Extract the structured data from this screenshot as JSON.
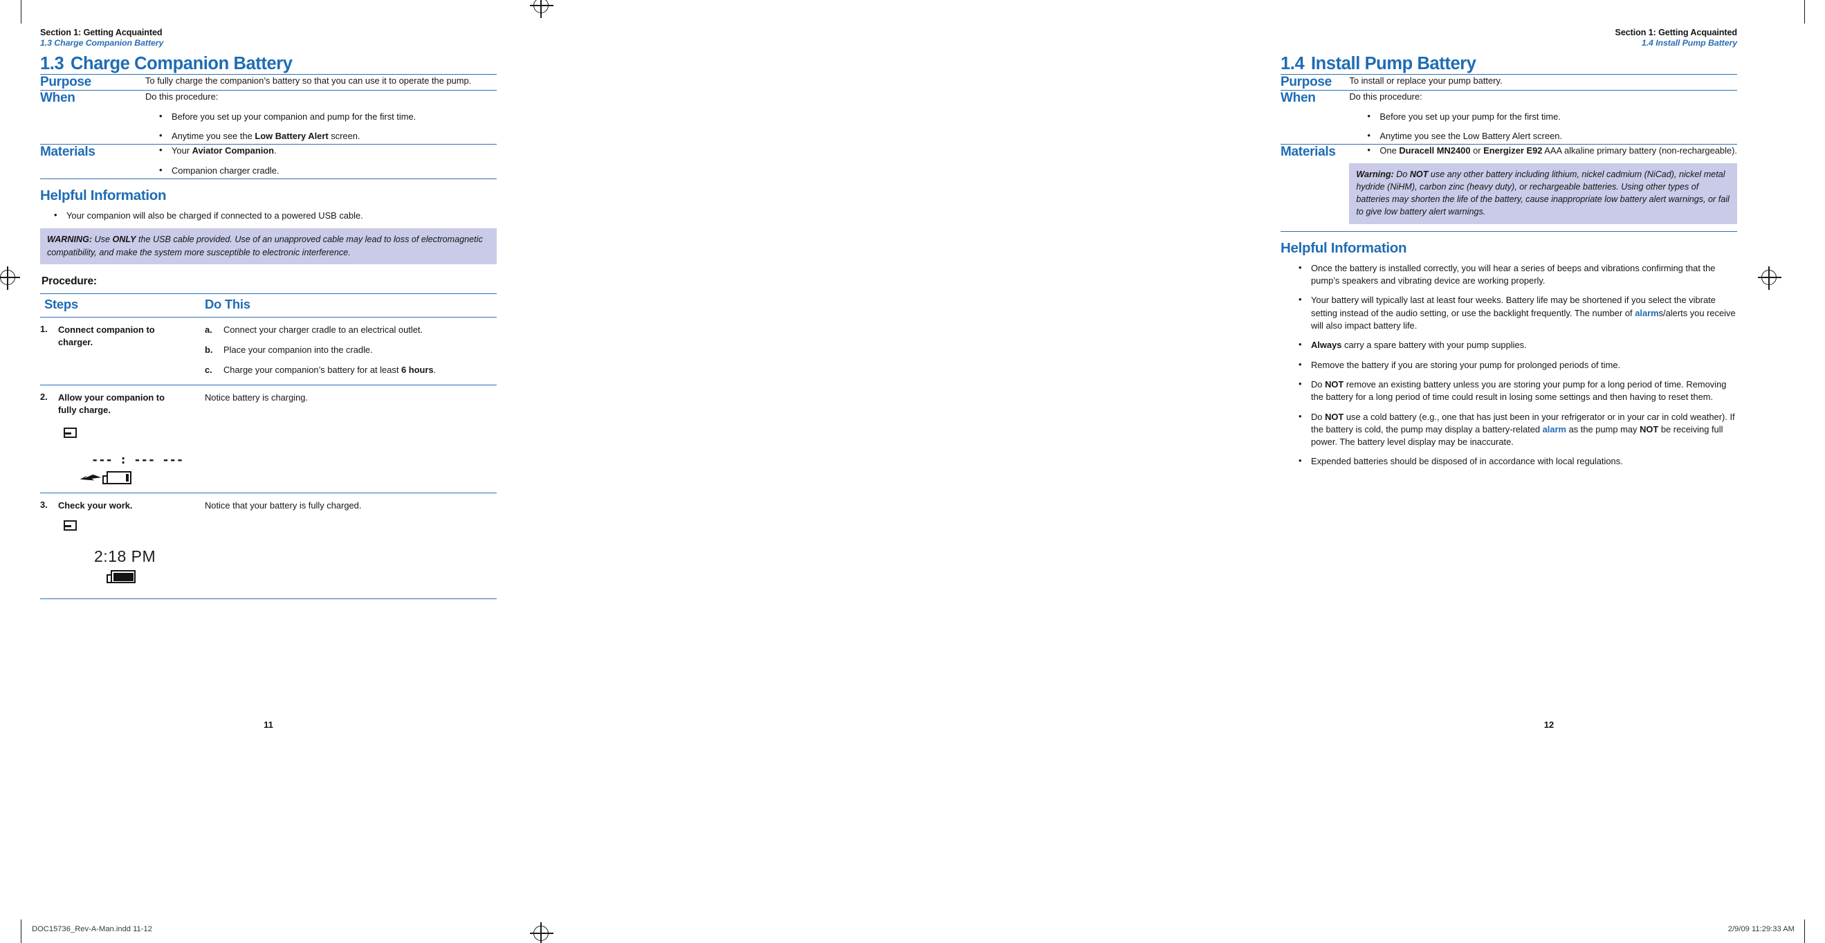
{
  "accent_color": "#1f6cb4",
  "warning_bg": "#c9cbe8",
  "left_page": {
    "runhead": {
      "section": "Section 1: Getting Acquainted",
      "subsection": "1.3 Charge Companion Battery"
    },
    "chapter": {
      "number": "1.3",
      "title": "Charge Companion Battery"
    },
    "info": {
      "purpose_label": "Purpose",
      "purpose_text": "To fully charge the companion’s battery so that you can use it to operate the pump.",
      "when_label": "When",
      "when_intro": "Do this procedure:",
      "when_bullets": [
        {
          "pre": "Before you set up your companion and pump for the first time.",
          "bold": "",
          "post": ""
        },
        {
          "pre": "Anytime you see the ",
          "bold": "Low Battery Alert",
          "post": " screen."
        }
      ],
      "materials_label": "Materials",
      "materials_bullets": [
        {
          "pre": "Your ",
          "bold": "Aviator Companion",
          "post": "."
        },
        {
          "pre": "Companion charger cradle.",
          "bold": "",
          "post": ""
        }
      ]
    },
    "helpful": {
      "heading": "Helpful Information",
      "bullets": [
        "Your companion will also be charged if connected to a powered USB cable."
      ]
    },
    "warning": {
      "lead": "WARNING:",
      "part1": " Use ",
      "emphasis": "ONLY",
      "part2": " the USB cable provided. Use of an unapproved cable may lead to loss of electromagnetic compatibility, and make the system more susceptible to electronic interference."
    },
    "procedure_heading": "Procedure:",
    "procedure": {
      "col_steps": "Steps",
      "col_do": "Do This",
      "rows": [
        {
          "num": "1.",
          "title": "Connect companion to charger.",
          "substeps": [
            {
              "letter": "a.",
              "pre": "Connect your charger cradle to an electrical outlet.",
              "bold": "",
              "post": ""
            },
            {
              "letter": "b.",
              "pre": "Place your companion into the cradle.",
              "bold": "",
              "post": ""
            },
            {
              "letter": "c.",
              "pre": "Charge your companion’s battery for at least ",
              "bold": "6 hours",
              "post": "."
            }
          ],
          "do_text": ""
        },
        {
          "num": "2.",
          "title": "Allow your companion to fully charge.",
          "substeps": [],
          "do_text": "Notice battery is charging.",
          "screen": {
            "logo": "abbott-logo-icon",
            "time": "--- : ---  ---",
            "battery": "low",
            "charging": true
          }
        },
        {
          "num": "3.",
          "title": "Check your work.",
          "substeps": [],
          "do_text": "Notice that your battery is fully charged.",
          "screen": {
            "logo": "abbott-logo-icon",
            "time": "2:18 PM",
            "battery": "full",
            "charging": false
          }
        }
      ]
    },
    "folio": "11"
  },
  "right_page": {
    "runhead": {
      "section": "Section 1: Getting Acquainted",
      "subsection": "1.4 Install Pump Battery"
    },
    "chapter": {
      "number": "1.4",
      "title": "Install Pump Battery"
    },
    "info": {
      "purpose_label": "Purpose",
      "purpose_text": "To install or replace your pump battery.",
      "when_label": "When",
      "when_intro": "Do this procedure:",
      "when_bullets": [
        {
          "pre": "Before you set up your pump for the first time.",
          "bold": "",
          "post": ""
        },
        {
          "pre": "Anytime you see the Low Battery Alert screen.",
          "bold": "",
          "post": ""
        }
      ],
      "materials_label": "Materials",
      "materials_bullets": [
        {
          "pre": "One ",
          "bold": "Duracell MN2400",
          "mid": " or ",
          "bold2": "Energizer E92",
          "post": " AAA alkaline primary battery (non-rechargeable)."
        }
      ]
    },
    "warning": {
      "lead": "Warning:",
      "part1": " Do ",
      "emphasis": "NOT",
      "part2": " use any other battery including lithium, nickel cadmium (NiCad), nickel metal hydride (NiHM), carbon zinc (heavy duty), or rechargeable batteries. Using other types of batteries may shorten the life of the battery, cause inappropriate low battery alert warnings, or fail to give low battery alert warnings."
    },
    "helpful": {
      "heading": "Helpful Information",
      "bullets": [
        {
          "segments": [
            {
              "t": "Once the battery is installed correctly, you will hear a series of beeps and vibrations confirming that the pump’s speakers and vibrating device are working properly.",
              "s": "n"
            }
          ]
        },
        {
          "segments": [
            {
              "t": "Your battery will typically last at least four weeks. Battery life may be shortened if you select the vibrate setting instead of the audio setting, or use the backlight frequently. The number of ",
              "s": "n"
            },
            {
              "t": "alarm",
              "s": "a"
            },
            {
              "t": "s/alerts you receive will also impact battery life.",
              "s": "n"
            }
          ]
        },
        {
          "segments": [
            {
              "t": "Always",
              "s": "b"
            },
            {
              "t": " carry a spare battery with your pump supplies.",
              "s": "n"
            }
          ]
        },
        {
          "segments": [
            {
              "t": "Remove the battery if you are storing your pump for prolonged periods of time.",
              "s": "n"
            }
          ]
        },
        {
          "segments": [
            {
              "t": "Do ",
              "s": "n"
            },
            {
              "t": "NOT",
              "s": "b"
            },
            {
              "t": " remove an existing battery unless you are storing your pump for a long period of time. Removing the battery for a long period of time could result in losing some settings and then having to reset them.",
              "s": "n"
            }
          ]
        },
        {
          "segments": [
            {
              "t": "Do ",
              "s": "n"
            },
            {
              "t": "NOT",
              "s": "b"
            },
            {
              "t": " use a cold battery (e.g., one that has just been in your refrigerator or in your car in cold weather). If the battery is cold, the pump may display a battery-related ",
              "s": "n"
            },
            {
              "t": "alarm",
              "s": "a"
            },
            {
              "t": " as the pump may ",
              "s": "n"
            },
            {
              "t": "NOT",
              "s": "b"
            },
            {
              "t": " be receiving full power. The battery level display may be inaccurate.",
              "s": "n"
            }
          ]
        },
        {
          "segments": [
            {
              "t": "Expended batteries should be disposed of in accordance with local regulations.",
              "s": "n"
            }
          ]
        }
      ]
    },
    "folio": "12"
  },
  "sheet_footer": {
    "file": "DOC15736_Rev-A-Man.indd   11-12",
    "timestamp": "2/9/09   11:29:33 AM"
  }
}
